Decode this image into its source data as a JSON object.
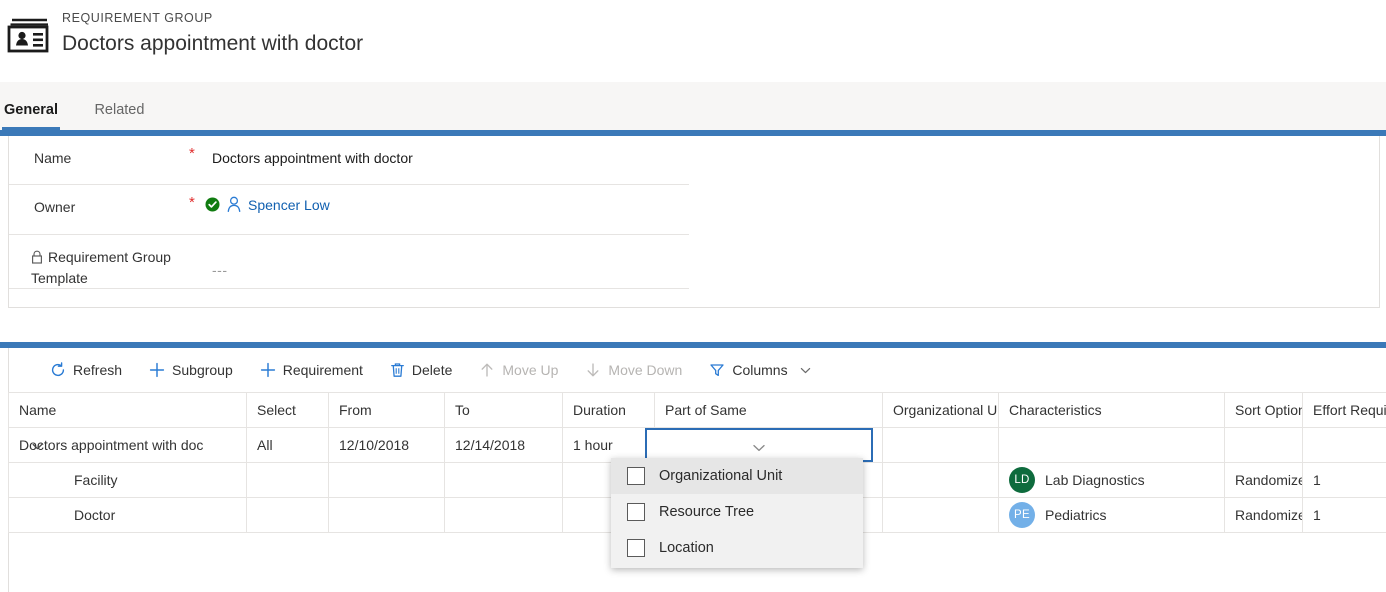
{
  "header": {
    "entity_kind": "REQUIREMENT GROUP",
    "record_title": "Doctors appointment with doctor",
    "icon": "contact-card-icon"
  },
  "tabs": [
    {
      "label": "General",
      "selected": true
    },
    {
      "label": "Related",
      "selected": false
    }
  ],
  "form": {
    "fields": [
      {
        "label": "Name",
        "required": true,
        "value": "Doctors appointment with doctor",
        "type": "text"
      },
      {
        "label": "Owner",
        "required": true,
        "value": "Spencer Low",
        "type": "lookup",
        "status_icon": "verified-check-icon",
        "person_icon": "person-icon"
      },
      {
        "label": "Requirement Group Template",
        "required": false,
        "value": "---",
        "type": "locked",
        "lock_icon": "lock-icon"
      }
    ]
  },
  "commandbar": {
    "buttons": [
      {
        "label": "Refresh",
        "icon": "refresh-icon",
        "disabled": false
      },
      {
        "label": "Subgroup",
        "icon": "plus-icon",
        "disabled": false
      },
      {
        "label": "Requirement",
        "icon": "plus-icon",
        "disabled": false
      },
      {
        "label": "Delete",
        "icon": "trash-icon",
        "disabled": false
      },
      {
        "label": "Move Up",
        "icon": "arrow-up-icon",
        "disabled": true
      },
      {
        "label": "Move Down",
        "icon": "arrow-down-icon",
        "disabled": true
      },
      {
        "label": "Columns",
        "icon": "filter-icon",
        "disabled": false,
        "caret": true
      }
    ]
  },
  "grid": {
    "columns": [
      "Name",
      "Select",
      "From",
      "To",
      "Duration",
      "Part of Same",
      "Organizational Unit",
      "Characteristics",
      "Sort Option",
      "Effort Required"
    ],
    "rows": [
      {
        "name": "Doctors appointment with doc",
        "level": 0,
        "expanded": true,
        "select": "All",
        "from": "12/10/2018",
        "to": "12/14/2018",
        "duration": "1 hour",
        "part_of_same": "",
        "organizational_unit": "",
        "characteristic": "",
        "characteristic_initials": "",
        "sort_option": "",
        "effort_required": ""
      },
      {
        "name": "Facility",
        "level": 1,
        "select": "",
        "from": "",
        "to": "",
        "duration": "",
        "part_of_same": "",
        "organizational_unit": "",
        "characteristic": "Lab Diagnostics",
        "characteristic_initials": "LD",
        "characteristic_color": "#0e6b3d",
        "sort_option": "Randomize",
        "effort_required": "1"
      },
      {
        "name": "Doctor",
        "level": 1,
        "select": "",
        "from": "",
        "to": "",
        "duration": "",
        "part_of_same": "",
        "organizational_unit": "",
        "characteristic": "Pediatrics",
        "characteristic_initials": "PE",
        "characteristic_color": "#73b0e8",
        "sort_option": "Randomize",
        "effort_required": "1"
      }
    ]
  },
  "dropdown": {
    "open": true,
    "field": "part-of-same",
    "options": [
      {
        "label": "Organizational Unit",
        "checked": false,
        "hovered": true
      },
      {
        "label": "Resource Tree",
        "checked": false,
        "hovered": false
      },
      {
        "label": "Location",
        "checked": false,
        "hovered": false
      }
    ]
  },
  "colors": {
    "accent_blue": "#3b79b8",
    "link_blue": "#1160b0",
    "icon_blue": "#2a7bd4",
    "required_red": "#e12d2d",
    "verified_green": "#107c10"
  }
}
